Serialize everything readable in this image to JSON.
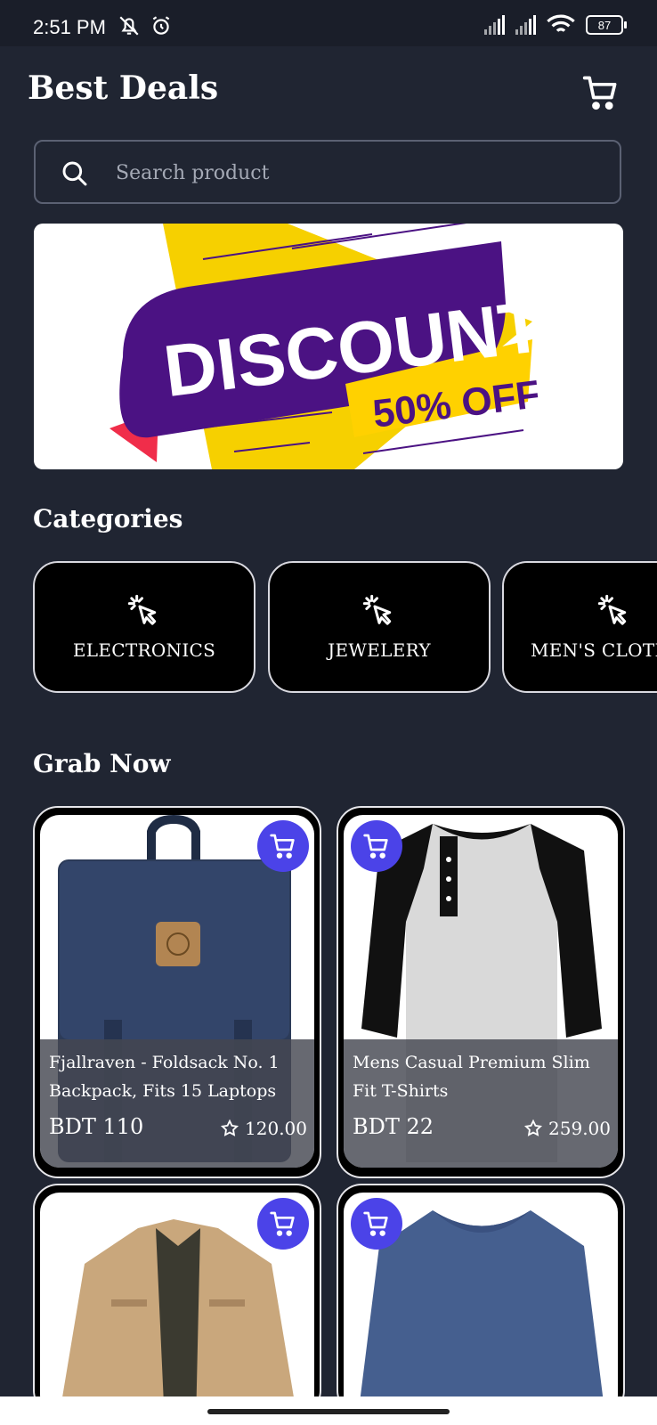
{
  "status": {
    "time": "2:51 PM",
    "battery": "87"
  },
  "header": {
    "title": "Best Deals"
  },
  "search": {
    "placeholder": "Search product"
  },
  "banner": {
    "headline": "DISCOUNT",
    "offer": "50% OFF"
  },
  "categories": {
    "title": "Categories",
    "items": [
      {
        "label": "ELECTRONICS"
      },
      {
        "label": "JEWELERY"
      },
      {
        "label": "MEN'S CLOTHING"
      }
    ]
  },
  "grab_now": {
    "title": "Grab Now",
    "products": [
      {
        "title": "Fjallraven - Foldsack No. 1 Backpack, Fits 15 Laptops",
        "price": "BDT 110",
        "rating": "120.00"
      },
      {
        "title": "Mens Casual Premium Slim Fit T-Shirts",
        "price": "BDT 22",
        "rating": "259.00"
      },
      {
        "title": "",
        "price": "",
        "rating": ""
      },
      {
        "title": "",
        "price": "",
        "rating": ""
      }
    ]
  },
  "colors": {
    "background": "#202532",
    "accent": "#4b43e8",
    "banner_purple": "#4b1283",
    "banner_yellow": "#f6d000"
  }
}
